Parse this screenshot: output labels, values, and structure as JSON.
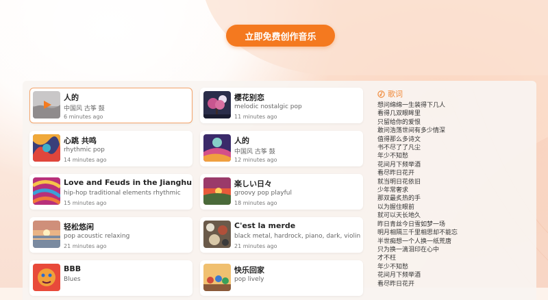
{
  "cta": {
    "label": "立即免费创作音乐"
  },
  "colors": {
    "accent": "#f4791f",
    "accent_light": "#f4a46a",
    "lyrics_title": "#f08a3a"
  },
  "songs": [
    {
      "title": "人的",
      "tags": "中国风 古筝 鼓",
      "time": "6 minutes ago",
      "thumb": "misty-landscape",
      "playing": true
    },
    {
      "title": "樱花别恋",
      "tags": "melodic nostalgic pop",
      "time": "11 minutes ago",
      "thumb": "cherry-blossom-tree"
    },
    {
      "title": "心跳 共鸣",
      "tags": "rhythmic pop",
      "time": "14 minutes ago",
      "thumb": "colorful-abstract"
    },
    {
      "title": "人的",
      "tags": "中国风 古筝 鼓",
      "time": "12 minutes ago",
      "thumb": "colorful-hills"
    },
    {
      "title": "Love and Feuds in the Jianghu",
      "tags": "hip-hop traditional elements rhythmic",
      "time": "15 minutes ago",
      "thumb": "swirl-abstract"
    },
    {
      "title": "楽しい日々",
      "tags": "groovy pop playful",
      "time": "18 minutes ago",
      "thumb": "sunset-field"
    },
    {
      "title": "轻松悠闲",
      "tags": "pop acoustic relaxing",
      "time": "21 minutes ago",
      "thumb": "sunset-sea"
    },
    {
      "title": "C'est la merde",
      "tags": "black metal, hardrock, piano, dark, violin",
      "time": "21 minutes ago",
      "thumb": "grunge-collage"
    },
    {
      "title": "BBB",
      "tags": "Blues",
      "time": "",
      "thumb": "colorful-face"
    },
    {
      "title": "快乐回家",
      "tags": "pop lively",
      "time": "",
      "thumb": "crowd-festival"
    }
  ],
  "lyrics": {
    "heading": "歌词",
    "lines": [
      "想问绵绵一生装得下几人",
      "看得几双眼眸里",
      "只留给你的爱恨",
      "敢问浩荡世间有多少情深",
      "值得那么多诗文",
      "书不尽了了凡尘",
      "年少不知愁",
      "花间月下频举酒",
      "看尽昨日花开",
      "就当明日花依旧",
      "少年常奢求",
      "那双最炙热的手",
      "以为握住眼前",
      "就可以天长地久",
      "昨日青丝今日雪如梦一场",
      "明月相隔三千里相思却不能忘",
      "半世痴想一个人换一纸荒唐",
      "只为换一滴泪印在心中",
      "才不枉",
      "年少不知愁",
      "花间月下频举酒",
      "看尽昨日花开"
    ]
  }
}
